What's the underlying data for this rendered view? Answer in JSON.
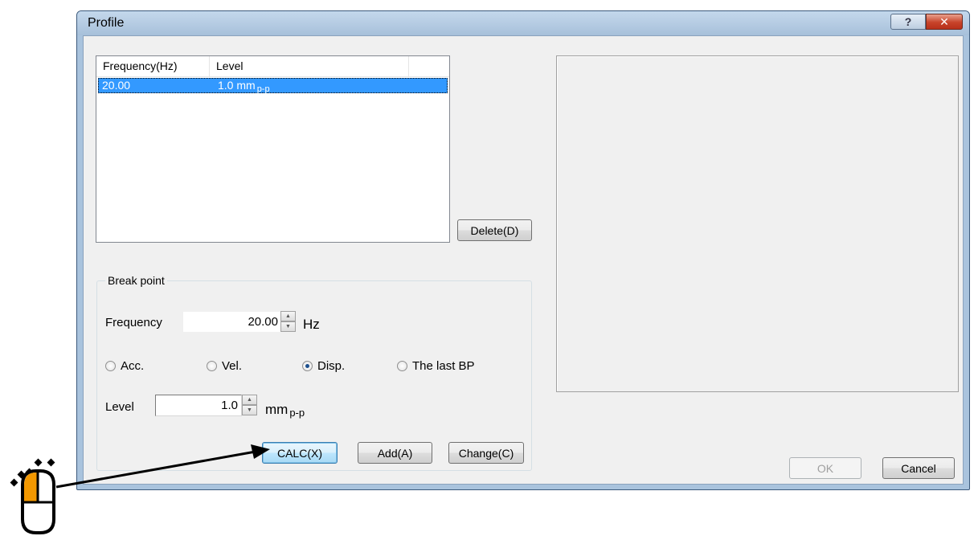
{
  "window": {
    "title": "Profile",
    "help_glyph": "?",
    "close_glyph": "✕"
  },
  "list": {
    "columns": [
      "Frequency(Hz)",
      "Level"
    ],
    "rows": [
      {
        "frequency": "20.00",
        "level": "1.0 mm",
        "level_sub": "p-p"
      }
    ]
  },
  "buttons": {
    "delete": "Delete(D)",
    "calc": "CALC(X)",
    "add": "Add(A)",
    "change": "Change(C)",
    "ok": "OK",
    "cancel": "Cancel"
  },
  "breakpoint": {
    "title": "Break point",
    "frequency_label": "Frequency",
    "frequency_value": "20.00",
    "frequency_unit": "Hz",
    "radios": [
      {
        "label": "Acc.",
        "checked": false
      },
      {
        "label": "Vel.",
        "checked": false
      },
      {
        "label": "Disp.",
        "checked": true
      },
      {
        "label": "The last BP",
        "checked": false
      }
    ],
    "level_label": "Level",
    "level_value": "1.0",
    "level_unit": "mm",
    "level_unit_sub": "p-p"
  },
  "colors": {
    "selection": "#3399ff",
    "mouse_accent": "#f39800"
  },
  "icons": {
    "mouse": "mouse-click-icon",
    "spin_up": "spin-up-arrow-icon",
    "spin_down": "spin-down-arrow-icon"
  }
}
